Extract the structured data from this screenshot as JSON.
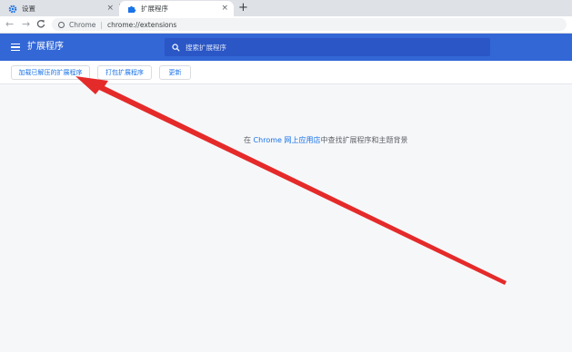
{
  "browser": {
    "tabs": [
      {
        "title": "设置",
        "icon": "gear-icon",
        "active": false
      },
      {
        "title": "扩展程序",
        "icon": "puzzle-icon",
        "active": true
      }
    ],
    "tab_close": "×",
    "new_tab": "+",
    "nav": {
      "back": "←",
      "forward": "→",
      "reload": "C"
    },
    "omnibox": {
      "chip": "Chrome",
      "separator": "|",
      "url": "chrome://extensions"
    }
  },
  "header": {
    "title": "扩展程序",
    "search_placeholder": "搜索扩展程序"
  },
  "dev_toolbar": {
    "load_unpacked": "加载已解压的扩展程序",
    "pack_extension": "打包扩展程序",
    "update": "更新"
  },
  "main": {
    "empty_prefix": "在",
    "store_link": "Chrome 网上应用店",
    "empty_suffix": "中查找扩展程序和主题背景"
  },
  "colors": {
    "header_bg": "#3367d6",
    "link": "#1a73e8",
    "annotation_arrow": "#e52a2a"
  }
}
